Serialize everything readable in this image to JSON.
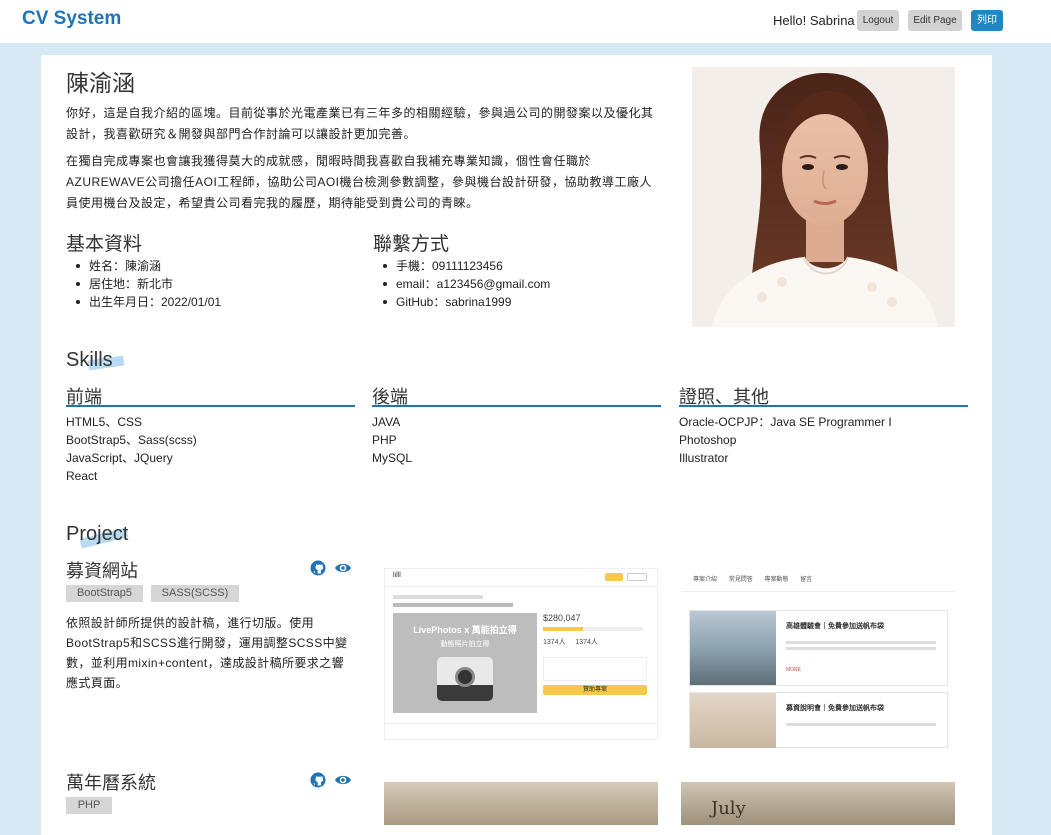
{
  "navbar": {
    "brand": "CV System",
    "greeting": "Hello! Sabrina",
    "logout_label": "Logout",
    "edit_label": "Edit Page",
    "print_label": "列印"
  },
  "profile": {
    "name": "陳渝涵",
    "intro_1": "你好，這是自我介紹的區塊。目前從事於光電產業已有三年多的相關經驗，參與過公司的開發案以及優化其設計，我喜歡研究＆開發與部門合作討論可以讓設計更加完善。",
    "intro_2": "在獨自完成專案也會讓我獲得莫大的成就感，閒暇時間我喜歡自我補充專業知識，個性會任職於AZUREWAVE公司擔任AOI工程師，協助公司AOI機台檢測參數調整，參與機台設計研發，協助教導工廠人員使用機台及設定，希望貴公司看完我的履歷，期待能受到貴公司的青睞。"
  },
  "basic_info": {
    "title": "基本資料",
    "items": [
      "姓名：陳渝涵",
      "居住地：新北市",
      "出生年月日：2022/01/01"
    ]
  },
  "contact": {
    "title": "聯繫方式",
    "items": [
      "手機：09111123456",
      "email：a123456@gmail.com",
      "GitHub：sabrina1999"
    ]
  },
  "skills": {
    "title": "Skills",
    "columns": [
      {
        "title": "前端",
        "items": [
          "HTML5、CSS",
          "BootStrap5、Sass(scss)",
          "JavaScript、JQuery",
          "React"
        ]
      },
      {
        "title": "後端",
        "items": [
          "JAVA",
          "PHP",
          "MySQL"
        ]
      },
      {
        "title": "證照、其他",
        "items": [
          "Oracle-OCPJP：Java SE Programmer I",
          "Photoshop",
          "Illustrator"
        ]
      }
    ]
  },
  "project": {
    "title": "Project",
    "items": [
      {
        "title": "募資網站",
        "tags": [
          "BootStrap5",
          "SASS(SCSS)"
        ],
        "desc": "依照設計師所提供的設計稿，進行切版。使用BootStrap5和SCSS進行開發，運用調整SCSS中變數，並利用mixin+content，達成設計稿所要求之響應式頁面。",
        "shot1": {
          "logo": "lilll",
          "banner": "LivePhotos x 萬能拍立得",
          "subbanner": "動態照片拍立得",
          "amount": "$280,047",
          "backers": "1374人",
          "days": "1374人",
          "cta": "贊助專案"
        },
        "shot2": {
          "tabs": [
            "專案介紹",
            "常見問答",
            "專案動態",
            "留言"
          ],
          "post1": "高雄體驗會｜免費參加送帆布袋",
          "post2": "募資說明會｜免費參加送帆布袋",
          "more": "MORE"
        }
      },
      {
        "title": "萬年曆系統",
        "tags": [
          "PHP"
        ],
        "shot_text": "July"
      }
    ]
  },
  "icons": {
    "github": "github-icon",
    "preview": "eye-icon"
  },
  "colors": {
    "accent": "#1f73b7",
    "print_button": "#1e88c7",
    "page_bg": "#d7e9f5"
  }
}
